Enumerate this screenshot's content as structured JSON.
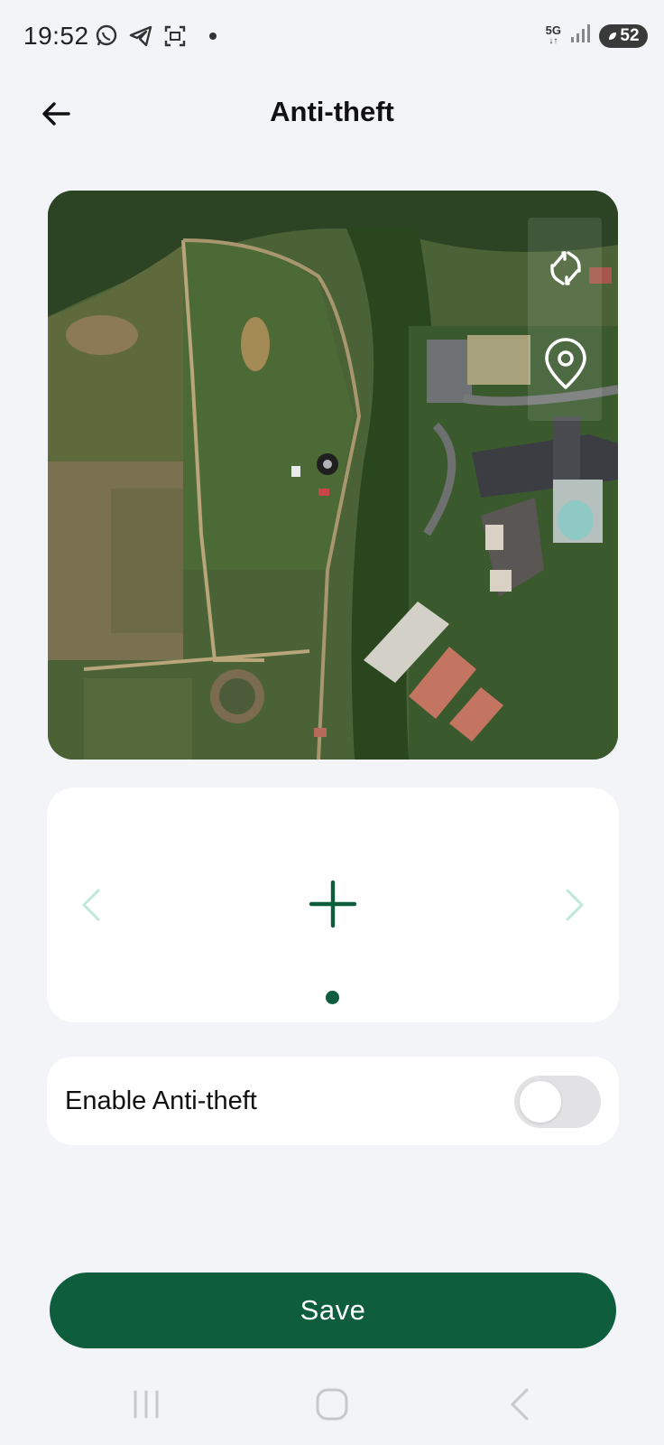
{
  "status_bar": {
    "time": "19:52",
    "network": "5G",
    "battery": "52",
    "icons": [
      "whatsapp-icon",
      "telegram-icon",
      "screenshot-icon",
      "notification-dot",
      "signal-icon",
      "battery-icon"
    ]
  },
  "header": {
    "title": "Anti-theft",
    "back_icon": "arrow-left-icon"
  },
  "map": {
    "view": "satellite",
    "buttons": [
      "refresh-icon",
      "location-pin-icon"
    ]
  },
  "carousel": {
    "prev_icon": "chevron-left-icon",
    "next_icon": "chevron-right-icon",
    "add_icon": "plus-icon",
    "page_count": 1,
    "current_page": 1
  },
  "anti_theft": {
    "label": "Enable Anti-theft",
    "enabled": false
  },
  "actions": {
    "save_label": "Save"
  },
  "colors": {
    "accent": "#0e5e3e",
    "chevron": "#bfe8dd",
    "background": "#f3f4f8",
    "toggle_off": "#e2e2e4"
  },
  "nav_bar": {
    "buttons": [
      "recents-icon",
      "home-icon",
      "back-icon"
    ]
  }
}
